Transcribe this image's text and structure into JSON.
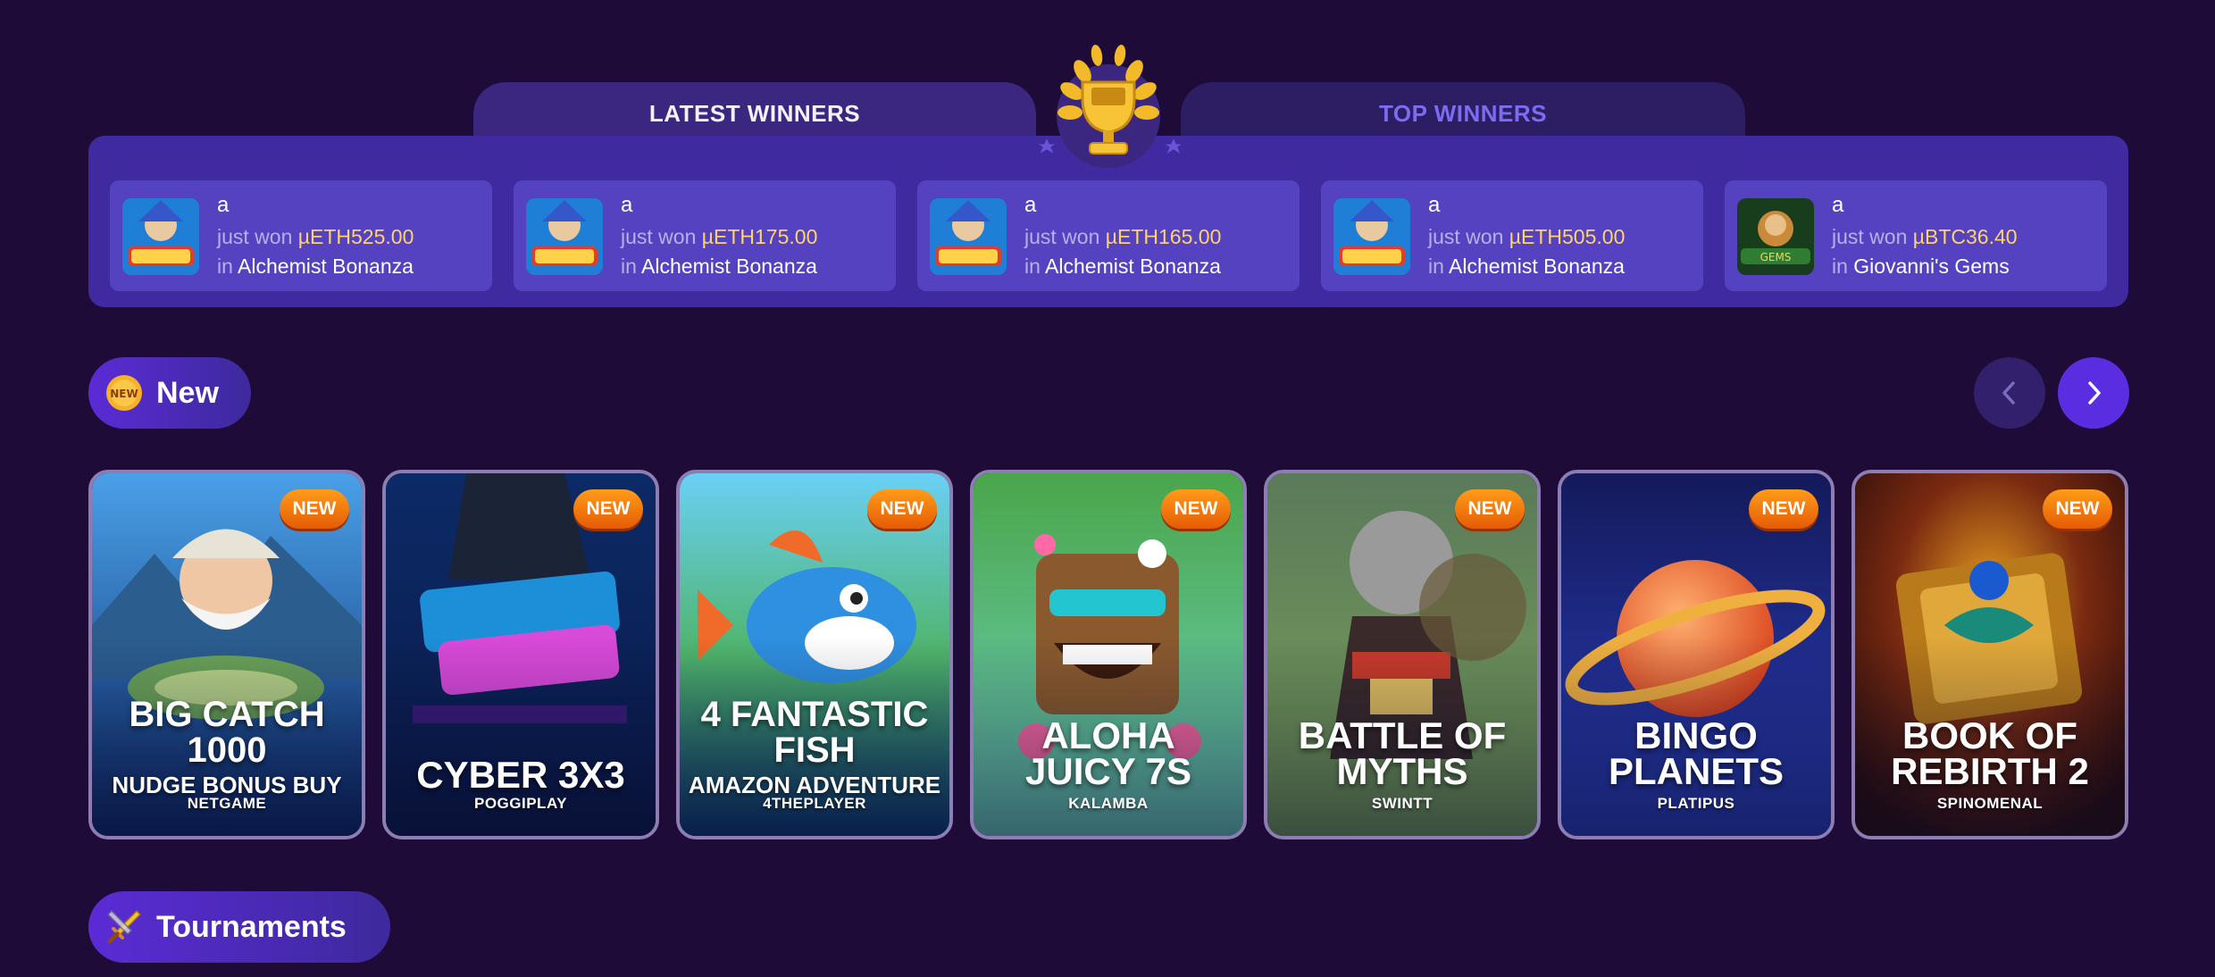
{
  "winners": {
    "tabs": {
      "latest": "LATEST WINNERS",
      "top": "TOP WINNERS"
    },
    "items": [
      {
        "user": "a",
        "prefix": "just won ",
        "amount": "µETH525.00",
        "in": "in ",
        "game": "Alchemist Bonanza"
      },
      {
        "user": "a",
        "prefix": "just won ",
        "amount": "µETH175.00",
        "in": "in ",
        "game": "Alchemist Bonanza"
      },
      {
        "user": "a",
        "prefix": "just won ",
        "amount": "µETH165.00",
        "in": "in ",
        "game": "Alchemist Bonanza"
      },
      {
        "user": "a",
        "prefix": "just won ",
        "amount": "µETH505.00",
        "in": "in ",
        "game": "Alchemist Bonanza"
      },
      {
        "user": "a",
        "prefix": "just won ",
        "amount": "µBTC36.40",
        "in": "in ",
        "game": "Giovanni's Gems"
      }
    ]
  },
  "sections": {
    "new": {
      "label": "New",
      "icon_text": "NEW"
    },
    "tournaments": {
      "label": "Tournaments"
    }
  },
  "games": [
    {
      "title": "BIG CATCH\n1000",
      "subtitle": "NUDGE BONUS BUY",
      "provider": "NETGAME",
      "badge": "NEW"
    },
    {
      "title": "CYBER 3X3",
      "subtitle": "",
      "provider": "POGGIPLAY",
      "badge": "NEW"
    },
    {
      "title": "4 FANTASTIC\nFISH",
      "subtitle": "AMAZON ADVENTURE",
      "provider": "4THEPLAYER",
      "badge": "NEW"
    },
    {
      "title": "ALOHA\nJUICY 7S",
      "subtitle": "",
      "provider": "KALAMBA",
      "badge": "NEW"
    },
    {
      "title": "BATTLE OF\nMYTHS",
      "subtitle": "",
      "provider": "SWINTT",
      "badge": "NEW"
    },
    {
      "title": "BINGO\nPLANETS",
      "subtitle": "",
      "provider": "PLATIPUS",
      "badge": "NEW"
    },
    {
      "title": "BOOK OF\nREBIRTH 2",
      "subtitle": "",
      "provider": "SPINOMENAL",
      "badge": "NEW"
    }
  ],
  "colors": {
    "background": "#1e0b37",
    "panel": "#3f2aa0",
    "card": "#5442c1",
    "accent_amount": "#ffd36a",
    "badge": "#ff8a10",
    "nav_next": "#5a2ee0"
  },
  "icons": {
    "trophy": "trophy-icon",
    "new": "new-badge-icon",
    "tournaments": "sword-icon",
    "prev": "chevron-left-icon",
    "next": "chevron-right-icon"
  }
}
